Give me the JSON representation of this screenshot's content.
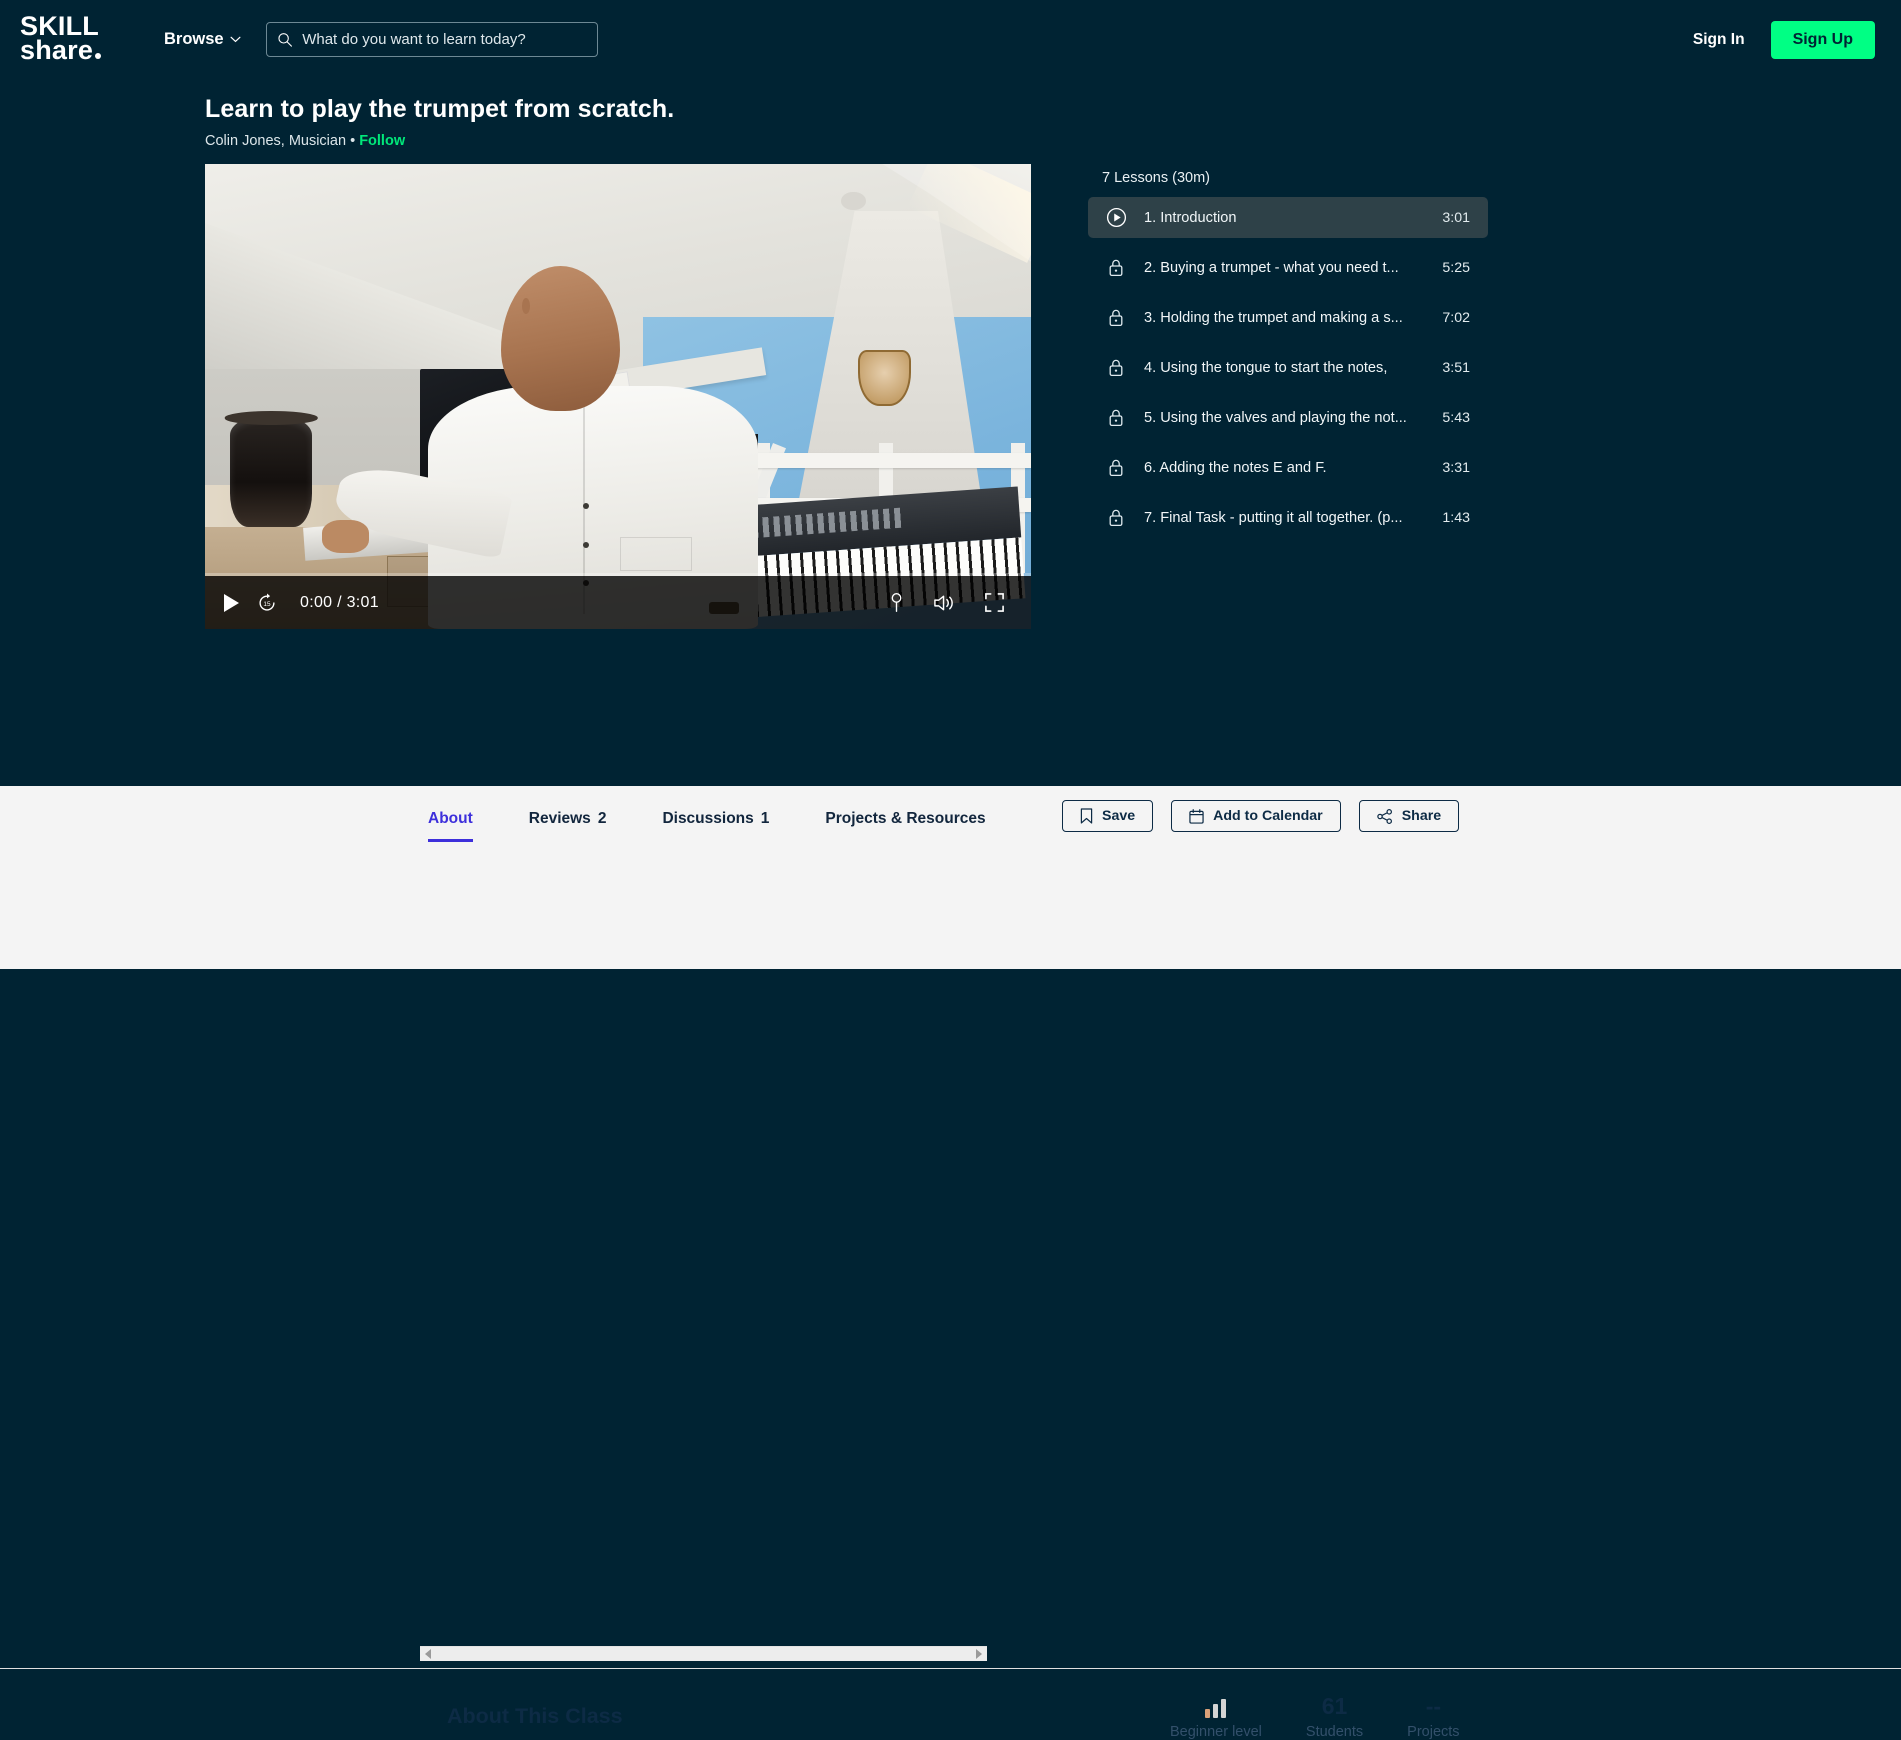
{
  "brand": {
    "logo_line1": "SKILL",
    "logo_line2": "share",
    "accent_green": "#00ff84",
    "dark_bg": "#002333"
  },
  "header": {
    "browse_label": "Browse",
    "search_placeholder": "What do you want to learn today?",
    "search_value": "",
    "sign_in_label": "Sign In",
    "sign_up_label": "Sign Up"
  },
  "hero": {
    "title": "Learn to play the trumpet from scratch.",
    "author": "Colin Jones, Musician",
    "separator": "•",
    "follow_label": "Follow"
  },
  "player": {
    "current_time": "0:00",
    "separator": "/",
    "duration": "3:01",
    "time_display": "0:00 / 3:01",
    "skip_seconds": "15",
    "progress_percent": 0
  },
  "lessons_panel": {
    "heading": "7 Lessons (30m)",
    "lessons": [
      {
        "title": "1. Introduction",
        "duration": "3:01",
        "state": "playing",
        "icon": "play-circle-icon"
      },
      {
        "title": "2. Buying a trumpet - what you need t...",
        "duration": "5:25",
        "state": "locked",
        "icon": "lock-icon"
      },
      {
        "title": "3. Holding the trumpet and making a s...",
        "duration": "7:02",
        "state": "locked",
        "icon": "lock-icon"
      },
      {
        "title": "4. Using the tongue to start the notes,",
        "duration": "3:51",
        "state": "locked",
        "icon": "lock-icon"
      },
      {
        "title": "5. Using the valves and playing the not...",
        "duration": "5:43",
        "state": "locked",
        "icon": "lock-icon"
      },
      {
        "title": "6. Adding the notes E and F.",
        "duration": "3:31",
        "state": "locked",
        "icon": "lock-icon"
      },
      {
        "title": "7. Final Task - putting it all together. (p...",
        "duration": "1:43",
        "state": "locked",
        "icon": "lock-icon"
      }
    ]
  },
  "tabs": {
    "active_color": "#3d2fdb",
    "items": [
      {
        "label": "About",
        "count": "",
        "active": true
      },
      {
        "label": "Reviews",
        "count": "2",
        "active": false
      },
      {
        "label": "Discussions",
        "count": "1",
        "active": false
      },
      {
        "label": "Projects & Resources",
        "count": "",
        "active": false
      }
    ]
  },
  "actions": {
    "save_label": "Save",
    "calendar_label": "Add to Calendar",
    "share_label": "Share"
  },
  "about": {
    "heading": "About This Class"
  },
  "stats": {
    "level_label": "Beginner level",
    "students_value": "61",
    "students_label": "Students",
    "projects_value": "--",
    "projects_label": "Projects"
  }
}
